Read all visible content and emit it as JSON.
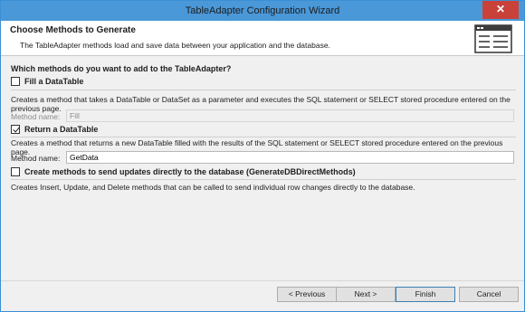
{
  "window": {
    "title": "TableAdapter Configuration Wizard",
    "close_glyph": "✕"
  },
  "header": {
    "title": "Choose Methods to Generate",
    "description": "The TableAdapter methods load and save data between your application and the database.",
    "icon": "wizard-form-icon"
  },
  "question": "Which methods do you want to add to the TableAdapter?",
  "options": [
    {
      "label": "Fill a DataTable",
      "checked": false,
      "description": "Creates a method that takes a DataTable or DataSet as a parameter and executes the SQL statement or SELECT stored procedure entered on the previous page.",
      "method_name_label": "Method name:",
      "method_name_value": "Fill",
      "enabled": false
    },
    {
      "label": "Return a DataTable",
      "checked": true,
      "description": "Creates a method that returns a new DataTable filled with the results of the SQL statement or SELECT stored procedure entered on the previous page.",
      "method_name_label": "Method name:",
      "method_name_value": "GetData",
      "enabled": true
    },
    {
      "label": "Create methods to send updates directly to the database (GenerateDBDirectMethods)",
      "checked": false,
      "description": "Creates Insert, Update, and Delete methods that can be called to send individual row changes directly to the database."
    }
  ],
  "buttons": {
    "previous": "< Previous",
    "next": "Next >",
    "finish": "Finish",
    "cancel": "Cancel"
  }
}
